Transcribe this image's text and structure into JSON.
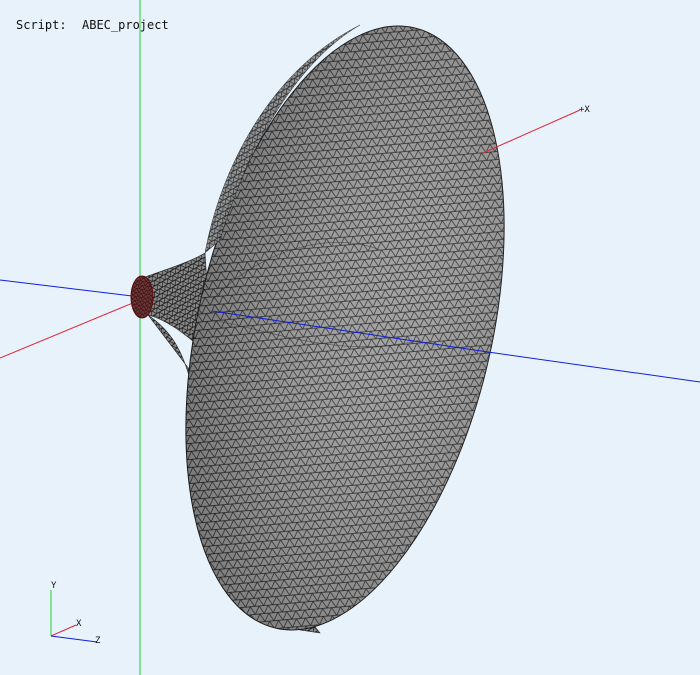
{
  "header": {
    "script_label": "Script:",
    "script_value": "ABEC_project"
  },
  "axes": {
    "plus_x_label": "+X",
    "gizmo_y": "Y",
    "gizmo_x": "X",
    "gizmo_z": "Z"
  },
  "colors": {
    "background": "#e8f2fb",
    "x_axis": "#e0263a",
    "y_axis": "#22cc33",
    "z_axis": "#1020d8",
    "mesh_fill": "#9a9a9a",
    "mesh_line": "#1a1a1a",
    "throat_mesh": "#8b1a1a"
  },
  "icons": {
    "mesh": "horn-mesh-icon",
    "gizmo": "orientation-gizmo-icon"
  }
}
